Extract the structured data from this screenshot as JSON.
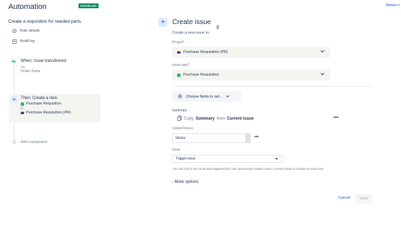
{
  "header": {
    "title": "Automation",
    "badge": "ENABLED",
    "return_link": "Return t"
  },
  "sidebar": {
    "rule_name": "Create a requisition for needed parts.",
    "items": [
      {
        "icon": "info-icon",
        "label": "Rule details"
      },
      {
        "icon": "document-icon",
        "label": "Audit log"
      }
    ],
    "trigger": {
      "icon": "transition-icon",
      "title": "When: Issue transitioned",
      "to_label": "TO",
      "to_value": "Order Parts"
    },
    "action": {
      "title": "Then: Create a new",
      "issue_type": "Purchase Requsition",
      "in_label": "in",
      "project": "Purchase Requisition (PR)"
    },
    "add_component": "Add component"
  },
  "panel": {
    "title": "Create issue",
    "subtitle": "Create a new issue in:",
    "project_label": "Project",
    "project_value": "Purchase Requisition (PR)",
    "issue_type_label": "Issue type",
    "issue_type_value": "Purchase Requisition",
    "choose_fields": "Choose fields to set...",
    "summary_label": "Summary",
    "summary_copy": "Copy",
    "summary_field": "Summary",
    "summary_from": "from",
    "summary_source": "Current issue",
    "linked_label": "Linked Issues",
    "linked_value": "blocks",
    "issue_label": "Issue",
    "issue_value": "Trigger issue",
    "help_text": "You can link to the issue that triggered this rule, previously created issue, a smart-value or simply an issue key.",
    "more_options": "More options",
    "cancel": "Cancel",
    "save": "Save"
  },
  "colors": {
    "accent": "#0052cc",
    "enabled_badge": "#00875a",
    "card_bg": "#f4f5f0"
  }
}
